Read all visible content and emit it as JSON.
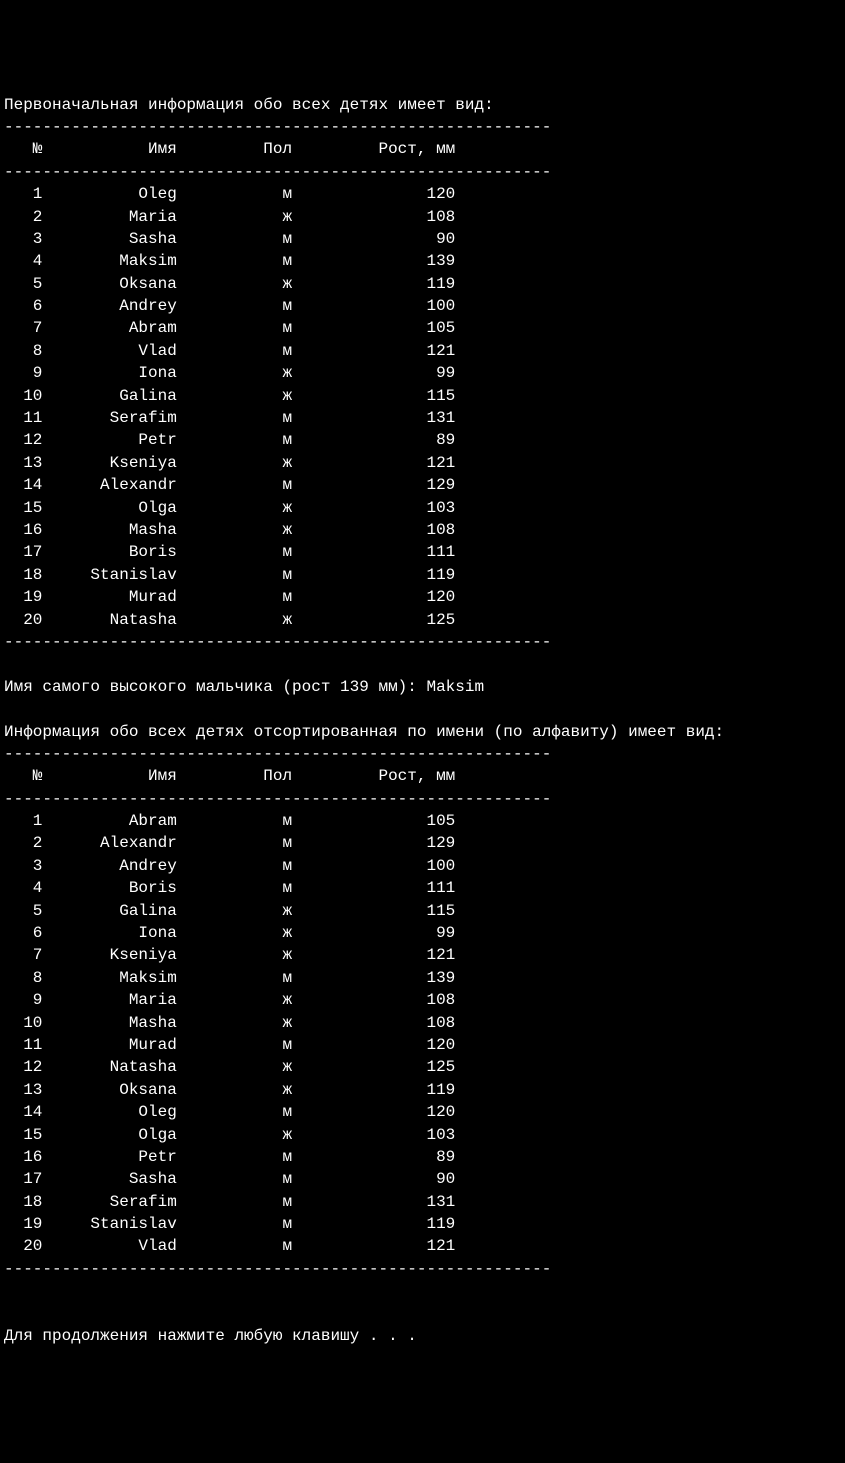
{
  "title1": "Первоначальная информация обо всех детях имеет вид:",
  "divider": "---------------------------------------------------------",
  "header": {
    "col1": "№",
    "col2": "Имя",
    "col3": "Пол",
    "col4": "Рост, мм"
  },
  "table1": [
    {
      "n": "1",
      "name": "Oleg",
      "sex": "м",
      "height": "120"
    },
    {
      "n": "2",
      "name": "Maria",
      "sex": "ж",
      "height": "108"
    },
    {
      "n": "3",
      "name": "Sasha",
      "sex": "м",
      "height": "90"
    },
    {
      "n": "4",
      "name": "Maksim",
      "sex": "м",
      "height": "139"
    },
    {
      "n": "5",
      "name": "Oksana",
      "sex": "ж",
      "height": "119"
    },
    {
      "n": "6",
      "name": "Andrey",
      "sex": "м",
      "height": "100"
    },
    {
      "n": "7",
      "name": "Abram",
      "sex": "м",
      "height": "105"
    },
    {
      "n": "8",
      "name": "Vlad",
      "sex": "м",
      "height": "121"
    },
    {
      "n": "9",
      "name": "Iona",
      "sex": "ж",
      "height": "99"
    },
    {
      "n": "10",
      "name": "Galina",
      "sex": "ж",
      "height": "115"
    },
    {
      "n": "11",
      "name": "Serafim",
      "sex": "м",
      "height": "131"
    },
    {
      "n": "12",
      "name": "Petr",
      "sex": "м",
      "height": "89"
    },
    {
      "n": "13",
      "name": "Kseniya",
      "sex": "ж",
      "height": "121"
    },
    {
      "n": "14",
      "name": "Alexandr",
      "sex": "м",
      "height": "129"
    },
    {
      "n": "15",
      "name": "Olga",
      "sex": "ж",
      "height": "103"
    },
    {
      "n": "16",
      "name": "Masha",
      "sex": "ж",
      "height": "108"
    },
    {
      "n": "17",
      "name": "Boris",
      "sex": "м",
      "height": "111"
    },
    {
      "n": "18",
      "name": "Stanislav",
      "sex": "м",
      "height": "119"
    },
    {
      "n": "19",
      "name": "Murad",
      "sex": "м",
      "height": "120"
    },
    {
      "n": "20",
      "name": "Natasha",
      "sex": "ж",
      "height": "125"
    }
  ],
  "tallest_line": "Имя самого высокого мальчика (рост 139 мм): Maksim",
  "title2": "Информация обо всех детях отсортированная по имени (по алфавиту) имеет вид:",
  "table2": [
    {
      "n": "1",
      "name": "Abram",
      "sex": "м",
      "height": "105"
    },
    {
      "n": "2",
      "name": "Alexandr",
      "sex": "м",
      "height": "129"
    },
    {
      "n": "3",
      "name": "Andrey",
      "sex": "м",
      "height": "100"
    },
    {
      "n": "4",
      "name": "Boris",
      "sex": "м",
      "height": "111"
    },
    {
      "n": "5",
      "name": "Galina",
      "sex": "ж",
      "height": "115"
    },
    {
      "n": "6",
      "name": "Iona",
      "sex": "ж",
      "height": "99"
    },
    {
      "n": "7",
      "name": "Kseniya",
      "sex": "ж",
      "height": "121"
    },
    {
      "n": "8",
      "name": "Maksim",
      "sex": "м",
      "height": "139"
    },
    {
      "n": "9",
      "name": "Maria",
      "sex": "ж",
      "height": "108"
    },
    {
      "n": "10",
      "name": "Masha",
      "sex": "ж",
      "height": "108"
    },
    {
      "n": "11",
      "name": "Murad",
      "sex": "м",
      "height": "120"
    },
    {
      "n": "12",
      "name": "Natasha",
      "sex": "ж",
      "height": "125"
    },
    {
      "n": "13",
      "name": "Oksana",
      "sex": "ж",
      "height": "119"
    },
    {
      "n": "14",
      "name": "Oleg",
      "sex": "м",
      "height": "120"
    },
    {
      "n": "15",
      "name": "Olga",
      "sex": "ж",
      "height": "103"
    },
    {
      "n": "16",
      "name": "Petr",
      "sex": "м",
      "height": "89"
    },
    {
      "n": "17",
      "name": "Sasha",
      "sex": "м",
      "height": "90"
    },
    {
      "n": "18",
      "name": "Serafim",
      "sex": "м",
      "height": "131"
    },
    {
      "n": "19",
      "name": "Stanislav",
      "sex": "м",
      "height": "119"
    },
    {
      "n": "20",
      "name": "Vlad",
      "sex": "м",
      "height": "121"
    }
  ],
  "continue_prompt": "Для продолжения нажмите любую клавишу . . ."
}
